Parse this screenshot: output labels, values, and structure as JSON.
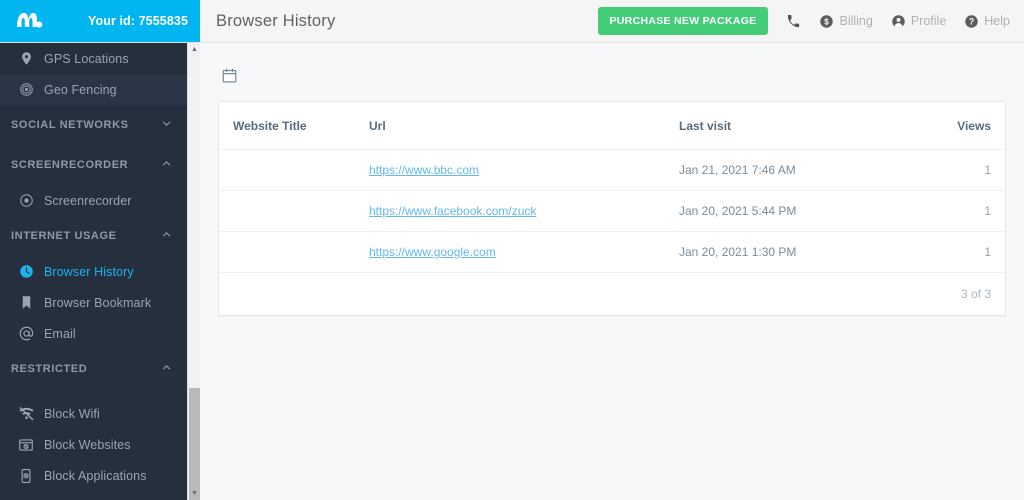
{
  "brand": {
    "logo_icon": "m-logo-icon",
    "user_id_label": "Your id: 7555835",
    "accent_color": "#00b5f0",
    "sidebar_color": "#262f3d"
  },
  "header": {
    "page_title": "Browser History",
    "purchase_button": "PURCHASE NEW PACKAGE",
    "purchase_color": "#43cd78",
    "actions": [
      {
        "label": "",
        "icon": "phone-icon"
      },
      {
        "label": "Billing",
        "icon": "dollar-circle-icon"
      },
      {
        "label": "Profile",
        "icon": "person-circle-icon"
      },
      {
        "label": "Help",
        "icon": "question-circle-icon"
      }
    ]
  },
  "sidebar": {
    "items": [
      {
        "type": "item",
        "label": "GPS Locations",
        "icon": "map-pin-icon",
        "state": "normal"
      },
      {
        "type": "item",
        "label": "Geo Fencing",
        "icon": "target-icon",
        "state": "hover"
      },
      {
        "type": "section",
        "label": "SOCIAL NETWORKS",
        "icon": "chevron-down-icon"
      },
      {
        "type": "section",
        "label": "SCREENRECORDER",
        "icon": "chevron-up-icon"
      },
      {
        "type": "item",
        "label": "Screenrecorder",
        "icon": "record-circle-icon",
        "state": "normal"
      },
      {
        "type": "section",
        "label": "INTERNET USAGE",
        "icon": "chevron-up-icon"
      },
      {
        "type": "item",
        "label": "Browser History",
        "icon": "clock-icon",
        "state": "active"
      },
      {
        "type": "item",
        "label": "Browser Bookmark",
        "icon": "bookmark-icon",
        "state": "normal"
      },
      {
        "type": "item",
        "label": "Email",
        "icon": "at-sign-icon",
        "state": "normal"
      },
      {
        "type": "section",
        "label": "RESTRICTED",
        "icon": "chevron-up-icon"
      },
      {
        "type": "item",
        "label": "Block Wifi",
        "icon": "wifi-off-icon",
        "state": "normal"
      },
      {
        "type": "item",
        "label": "Block Websites",
        "icon": "block-website-icon",
        "state": "normal"
      },
      {
        "type": "item",
        "label": "Block Applications",
        "icon": "block-app-icon",
        "state": "normal"
      }
    ]
  },
  "main": {
    "date_picker_icon": "calendar-icon",
    "table": {
      "columns": [
        "Website Title",
        "Url",
        "Last visit",
        "Views"
      ],
      "rows": [
        {
          "title": "",
          "url": "https://www.bbc.com",
          "last_visit": "Jan 21, 2021 7:46 AM",
          "views": "1"
        },
        {
          "title": "",
          "url": "https://www.facebook.com/zuck",
          "last_visit": "Jan 20, 2021 5:44 PM",
          "views": "1"
        },
        {
          "title": "",
          "url": "https://www.google.com",
          "last_visit": "Jan 20, 2021 1:30 PM",
          "views": "1"
        }
      ],
      "pager": "3 of 3",
      "link_color": "#62b9ef"
    }
  }
}
